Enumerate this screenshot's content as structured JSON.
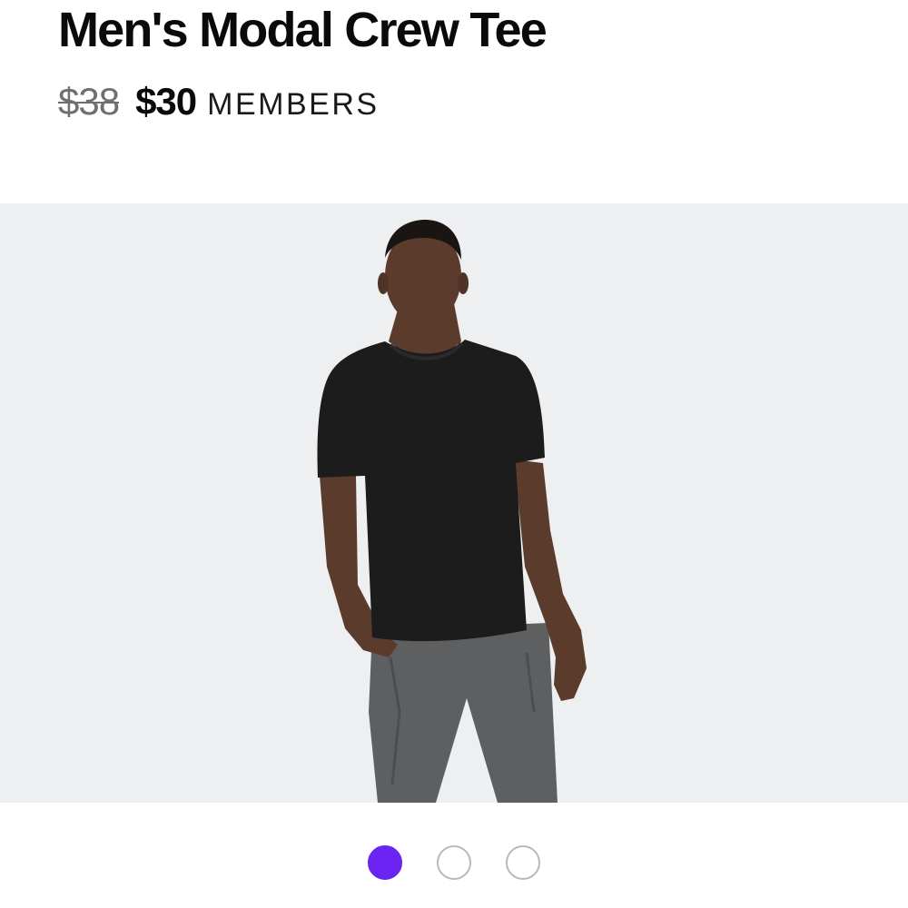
{
  "product": {
    "title": "Men's Modal Crew Tee",
    "price_original": "$38",
    "price_member": "$30",
    "price_member_label": "MEMBERS"
  },
  "carousel": {
    "image_alt": "Model wearing black crew neck tee and gray pants",
    "slide_count": 3,
    "active_index": 0
  },
  "colors": {
    "accent": "#6a23f0",
    "image_background": "#eeeff1",
    "tee": "#1c1c1d",
    "pants": "#5e5f61",
    "skin": "#5a3b2c"
  }
}
